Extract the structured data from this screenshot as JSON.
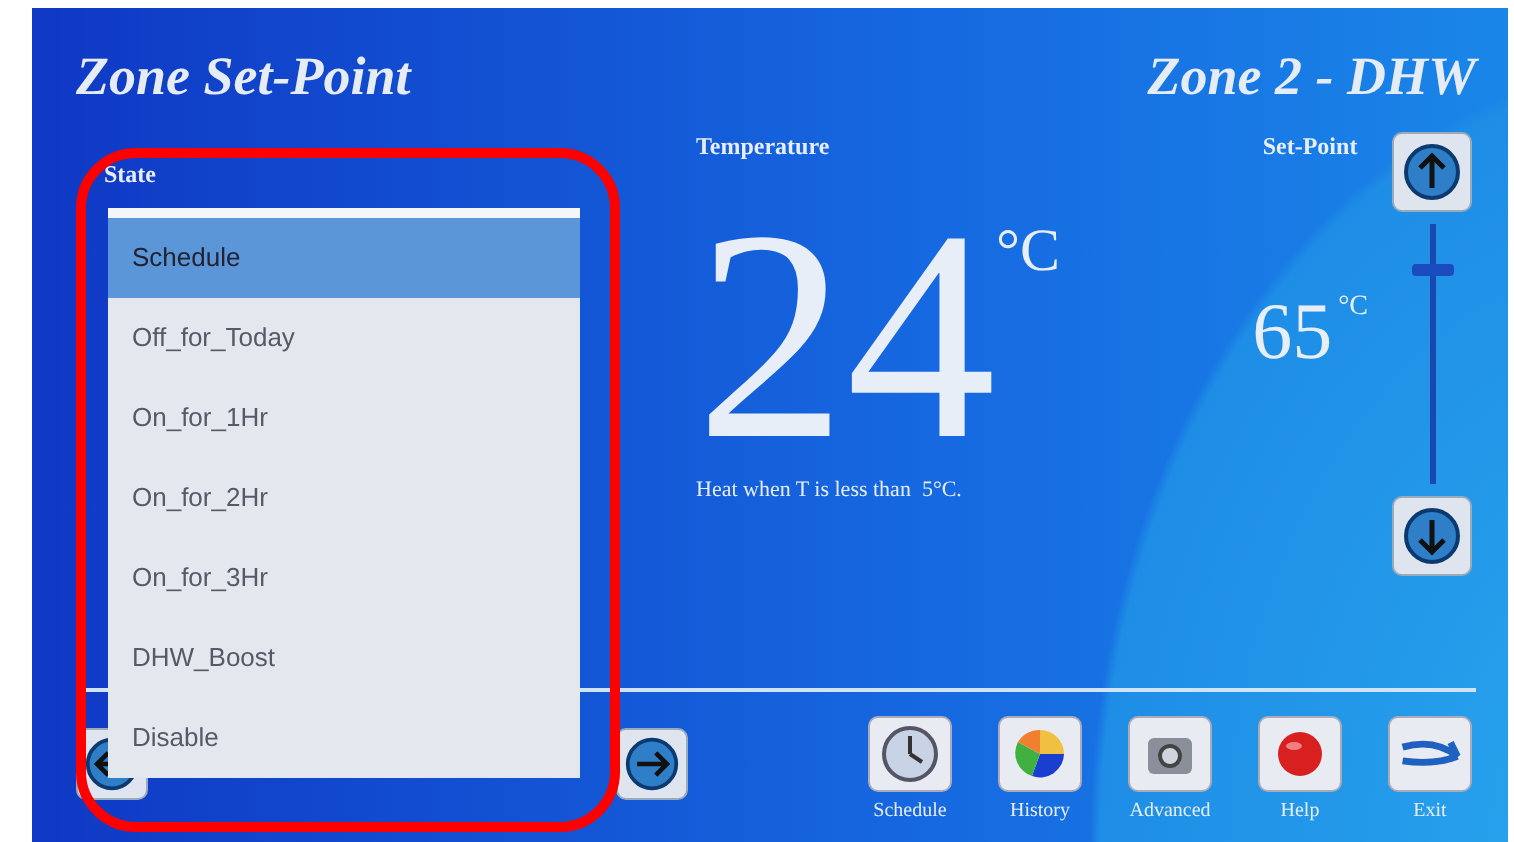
{
  "title": "Zone Set-Point",
  "zone": "Zone 2 - DHW",
  "state": {
    "label": "State",
    "options": [
      {
        "label": "Schedule",
        "selected": true
      },
      {
        "label": "Off_for_Today",
        "selected": false
      },
      {
        "label": "On_for_1Hr",
        "selected": false
      },
      {
        "label": "On_for_2Hr",
        "selected": false
      },
      {
        "label": "On_for_3Hr",
        "selected": false
      },
      {
        "label": "DHW_Boost",
        "selected": false
      },
      {
        "label": "Disable",
        "selected": false
      }
    ]
  },
  "temperature": {
    "label": "Temperature",
    "value": "24",
    "unit": "°C",
    "note": "Heat when T is less than  5°C."
  },
  "setpoint": {
    "label": "Set-Point",
    "value": "65",
    "unit": "°C",
    "level": 0.85
  },
  "nav": [
    {
      "label": "Schedule",
      "kind": "clock"
    },
    {
      "label": "History",
      "kind": "pie"
    },
    {
      "label": "Advanced",
      "kind": "machine"
    },
    {
      "label": "Help",
      "kind": "help"
    },
    {
      "label": "Exit",
      "kind": "exit"
    }
  ]
}
